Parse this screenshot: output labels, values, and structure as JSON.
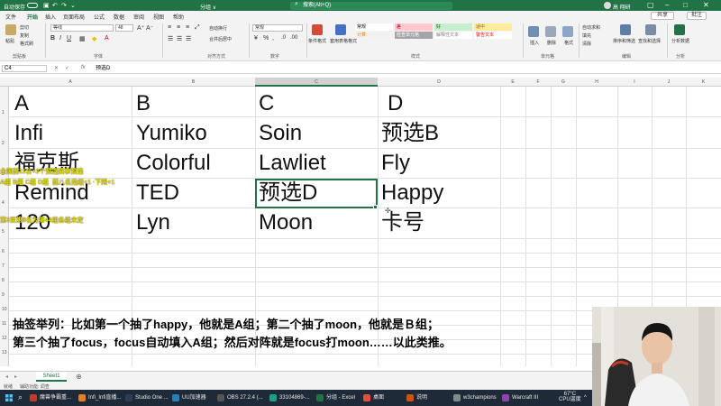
{
  "titlebar": {
    "autosave": "自动保存",
    "doc_name": "分组 ∨",
    "search_placeholder": "搜索(Alt+Q)",
    "user": "高 翔研",
    "accent": "#217346"
  },
  "tabs": [
    "文件",
    "开始",
    "插入",
    "页面布局",
    "公式",
    "数据",
    "审阅",
    "视图",
    "帮助"
  ],
  "tabs_active": "开始",
  "share_label": "共享",
  "comment_label": "批注",
  "ribbon": {
    "clipboard": {
      "paste": "粘贴",
      "cut": "剪切",
      "copy": "复制",
      "format_painter": "格式刷",
      "label": "剪贴板"
    },
    "font": {
      "name": "等线",
      "size": "48",
      "label": "字体"
    },
    "alignment": {
      "wrap": "自动换行",
      "merge": "合并后居中",
      "label": "对齐方式"
    },
    "number": {
      "format": "常规",
      "label": "数字"
    },
    "styles": {
      "conditional": "条件格式",
      "table_format": "套用表格格式",
      "cells": [
        {
          "text": "常规",
          "bg": "#ffffff",
          "fg": "#000000"
        },
        {
          "text": "差",
          "bg": "#ffc7ce",
          "fg": "#9c0006"
        },
        {
          "text": "好",
          "bg": "#c6efce",
          "fg": "#006100"
        },
        {
          "text": "适中",
          "bg": "#ffeb9c",
          "fg": "#9c5700"
        },
        {
          "text": "计算",
          "bg": "#f2f2f2",
          "fg": "#fa7d00"
        },
        {
          "text": "检查单元格",
          "bg": "#a5a5a5",
          "fg": "#ffffff"
        },
        {
          "text": "解释性文本",
          "bg": "#ffffff",
          "fg": "#7f7f7f"
        },
        {
          "text": "警告文本",
          "bg": "#ffffff",
          "fg": "#ff0000"
        }
      ],
      "label": "样式"
    },
    "cells": {
      "insert": "插入",
      "delete": "删除",
      "format": "格式",
      "label": "单元格"
    },
    "editing": {
      "autosum": "自动求和",
      "fill": "填充",
      "clear": "清除",
      "sort": "排序和筛选",
      "find": "查找和选择",
      "label": "编辑"
    },
    "analysis": {
      "analyze": "分析数据",
      "label": "分析"
    }
  },
  "formula_bar": {
    "namebox": "C4",
    "fx": "fx",
    "value": "预选D"
  },
  "columns": [
    "A",
    "B",
    "C",
    "D",
    "E",
    "F",
    "G",
    "H",
    "I",
    "J",
    "K"
  ],
  "selected_column": "C",
  "rows": [
    "1",
    "2",
    "3",
    "4",
    "5",
    "6",
    "7",
    "8",
    "9",
    "10",
    "11",
    "12",
    "13",
    "14",
    "15",
    "16",
    "17",
    "18",
    "19"
  ],
  "sheet": {
    "row1": [
      "A",
      "B",
      "C",
      "D"
    ],
    "row2": [
      "Infi",
      "Yumiko",
      "Soin",
      "预选B"
    ],
    "row3": [
      "福克斯",
      "Colorful",
      "Lawliet",
      "Fly"
    ],
    "row4": [
      "Remind",
      "TED",
      "预选D",
      "Happy"
    ],
    "row5": [
      "120",
      "Lyn",
      "Moon",
      "卡号"
    ]
  },
  "overlay": {
    "line1": "全国前11名+2个预选赛拿预选",
    "line2": "A组 B组 C组 D组",
    "line3": "前八名选组+1 ·下限+1",
    "line4": "第3至第8名为第44组各组未定"
  },
  "note": {
    "line1": "抽签举列：比如第一个抽了happy，他就是A组；第二个抽了moon，他就是Ｂ组；",
    "line2": "第三个抽了focus，focus自动填入A组；然后对阵就是focus打moon……以此类推。"
  },
  "sheet_tab": "Sheet1",
  "status": {
    "ready": "就绪",
    "accessibility": "辅助功能: 调查"
  },
  "taskbar": {
    "apps": [
      {
        "label": "魔兽争霸重...",
        "color": "#c0392b"
      },
      {
        "label": "Infi_Infi直播...",
        "color": "#e67e22"
      },
      {
        "label": "Studio One ...",
        "color": "#2c3e50"
      },
      {
        "label": "UU加速器",
        "color": "#2980b9"
      },
      {
        "label": "OBS 27.2.4 (...",
        "color": "#555555"
      },
      {
        "label": "33104869-...",
        "color": "#16a085"
      },
      {
        "label": "分组 - Excel",
        "color": "#217346"
      },
      {
        "label": "桌面",
        "color": "#e74c3c"
      },
      {
        "label": "说明",
        "color": "#d35400"
      },
      {
        "label": "w3champions",
        "color": "#7f8c8d"
      },
      {
        "label": "Warcraft III",
        "color": "#8e44ad"
      }
    ],
    "temp": "67°C",
    "cpu": "CPU温度"
  }
}
